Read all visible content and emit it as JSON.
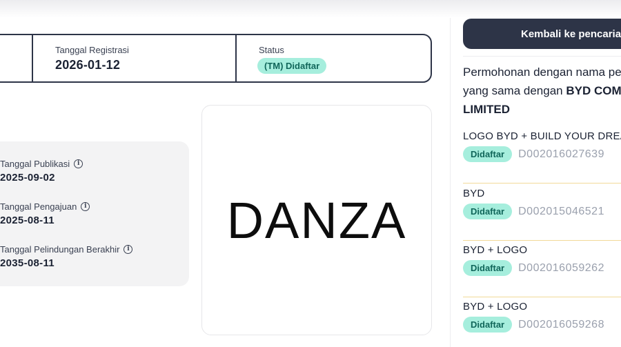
{
  "info_card": {
    "registration_label": "Tanggal Registrasi",
    "registration_value": "2026-01-12",
    "status_label": "Status",
    "status_value": "(TM) Didaftar"
  },
  "dates": [
    {
      "label": "Tanggal Publikasi",
      "value": "2025-09-02"
    },
    {
      "label": "Tanggal Pengajuan",
      "value": "2025-08-11"
    },
    {
      "label": "Tanggal Pelindungan Berakhir",
      "value": "2035-08-11"
    }
  ],
  "info_icon_glyph": "i",
  "mark": {
    "text": "DANZA"
  },
  "sidebar": {
    "back_button_label": "Kembali ke pencarian",
    "heading_prefix": "Permohonan dengan nama pemilik",
    "heading_line2_prefix": "yang sama dengan ",
    "heading_owner_line1": "BYD COMPANY",
    "heading_owner_line2": "LIMITED",
    "results": [
      {
        "name": "LOGO BYD + BUILD YOUR DREAMS",
        "status": "Didaftar",
        "id": "D002016027639"
      },
      {
        "name": "BYD",
        "status": "Didaftar",
        "id": "D002015046521"
      },
      {
        "name": "BYD + LOGO",
        "status": "Didaftar",
        "id": "D002016059262"
      },
      {
        "name": "BYD + LOGO",
        "status": "Didaftar",
        "id": "D002016059268"
      }
    ]
  },
  "colors": {
    "primary": "#2d3447",
    "badge_bg": "#a6eedd",
    "badge_text": "#10665a",
    "divider_accent": "#f1d998"
  }
}
